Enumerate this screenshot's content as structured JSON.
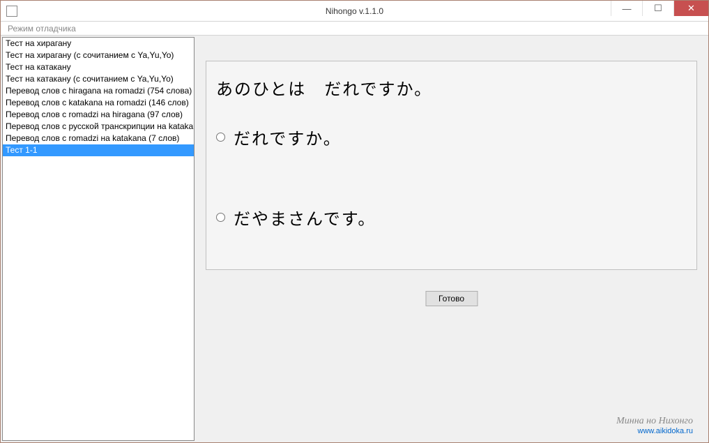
{
  "window": {
    "title": "Nihongo v.1.1.0"
  },
  "menu": {
    "debugger": "Режим отладчика"
  },
  "sidebar": {
    "items": [
      "Тест на хирагану",
      "Тест на хирагану (с сочитанием с Ya,Yu,Yo)",
      "Тест на катакану",
      "Тест на катакану (с сочитанием с Ya,Yu,Yo)",
      "Перевод слов с hiragana на romadzi (754 слова)",
      "Перевод слов с katakana на romadzi (146 слов)",
      "Перевод слов с romadzi на hiragana (97 слов)",
      "Перевод слов с русской транскрипции на katakana",
      "Перевод слов с romadzi на katakana (7 слов)",
      "Тест 1-1"
    ],
    "selectedIndex": 9
  },
  "quiz": {
    "question": "あのひとは　だれですか。",
    "answers": [
      "だれですか。",
      "だやまさんです。"
    ],
    "submit_label": "Готово"
  },
  "footer": {
    "title": "Минна но Нихонго",
    "url": "www.aikidoka.ru"
  }
}
